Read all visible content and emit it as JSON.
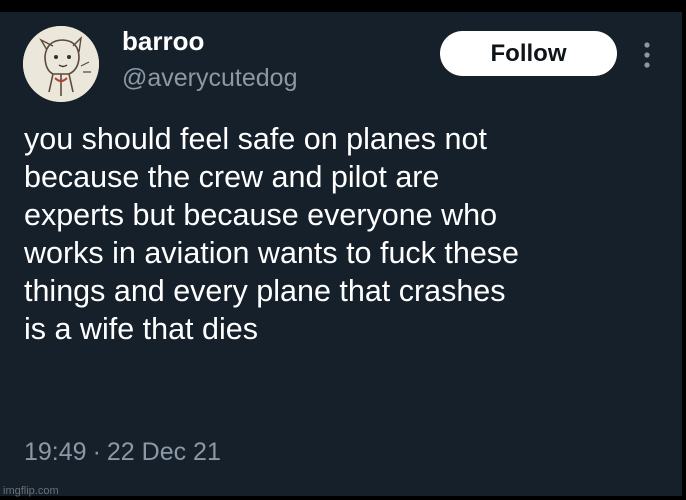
{
  "tweet": {
    "display_name": "barroo",
    "handle": "@averycutedog",
    "follow_label": "Follow",
    "more_icon": "more-vertical-icon",
    "text_lines": [
      "you should feel safe on planes not",
      "because the crew and pilot are",
      "experts but because everyone who",
      "works in aviation wants to fuck these",
      "things and every plane that crashes",
      "is a wife that dies"
    ],
    "time": "19:49",
    "separator": "·",
    "date": "22 Dec 21"
  },
  "watermark": {
    "text": "imgflip.com"
  },
  "colors": {
    "background": "#15202b",
    "secondary_text": "#8b98a5",
    "button_bg": "#ffffff",
    "button_text": "#0f1419"
  }
}
